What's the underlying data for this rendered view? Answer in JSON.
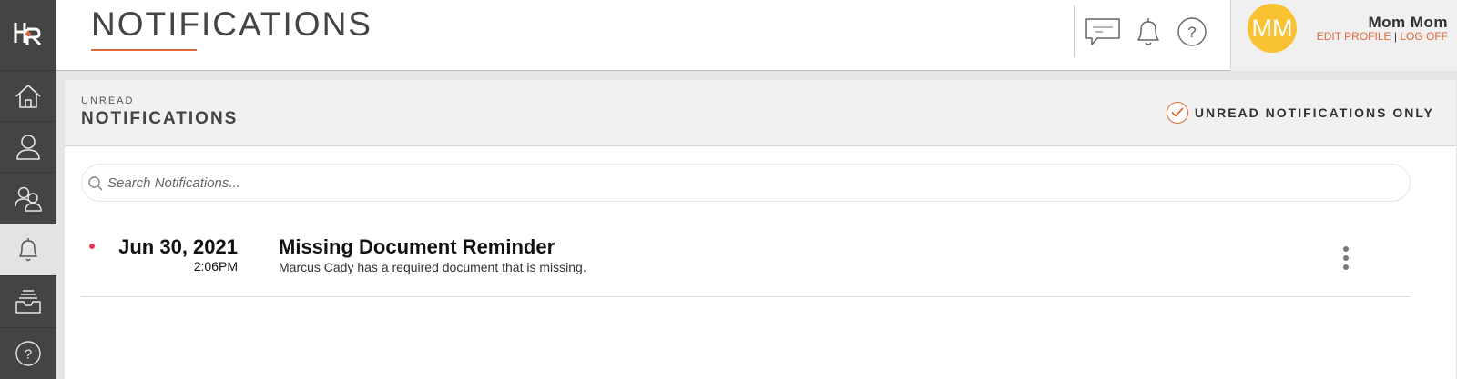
{
  "app": {
    "logo_text": "HR"
  },
  "sidebar": {
    "items": [
      {
        "name": "home",
        "icon": "home-icon"
      },
      {
        "name": "employee",
        "icon": "person-icon"
      },
      {
        "name": "team",
        "icon": "team-icon"
      },
      {
        "name": "notifications",
        "icon": "bell-icon",
        "active": true
      },
      {
        "name": "inbox",
        "icon": "inbox-tray-icon"
      },
      {
        "name": "help",
        "icon": "help-icon"
      }
    ]
  },
  "header": {
    "title": "NOTIFICATIONS",
    "icons": [
      "chat-icon",
      "bell-icon",
      "help-icon"
    ]
  },
  "profile": {
    "initials": "MM",
    "name": "Mom Mom",
    "edit_label": "EDIT PROFILE",
    "separator": "|",
    "logoff_label": "LOG OFF",
    "avatar_color": "#f9c233"
  },
  "panel": {
    "kicker": "UNREAD",
    "title": "NOTIFICATIONS",
    "filter_label": "UNREAD NOTIFICATIONS ONLY",
    "filter_checked": true
  },
  "search": {
    "placeholder": "Search Notifications...",
    "value": ""
  },
  "notifications": [
    {
      "date": "Jun 30, 2021",
      "time": "2:06PM",
      "title": "Missing Document Reminder",
      "body": "Marcus Cady has a required document that is missing.",
      "unread": true
    }
  ],
  "colors": {
    "accent": "#e0683a",
    "sidebar": "#444444",
    "unread_dot": "#e53b4f"
  }
}
